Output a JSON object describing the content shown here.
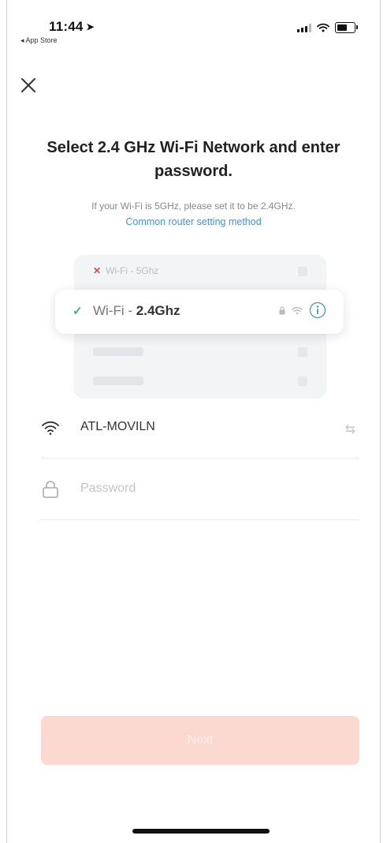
{
  "status_bar": {
    "time": "11:44",
    "back_app": "◂ App Store"
  },
  "page": {
    "title": "Select 2.4 GHz Wi-Fi Network and enter password.",
    "hint": "If your Wi-Fi is 5GHz, please set it to be 2.4GHz.",
    "link": "Common router setting method"
  },
  "illustration": {
    "wifi_5g_prefix": "Wi-Fi - ",
    "wifi_5g_band": "5Ghz",
    "wifi_24_prefix": "Wi-Fi - ",
    "wifi_24_band": "2.4Ghz"
  },
  "form": {
    "ssid": "ATL-MOVILN",
    "password_placeholder": "Password"
  },
  "footer": {
    "next_label": "Next"
  },
  "colors": {
    "accent_blue": "#4a8fd8",
    "check_green": "#3cb46e",
    "error_red": "#e9474c",
    "next_disabled_bg": "#fcd9d0"
  },
  "icons": [
    "location-arrow-icon",
    "signal-icon",
    "wifi-icon",
    "battery-icon",
    "close-icon",
    "x-icon",
    "check-icon",
    "lock-icon",
    "info-icon",
    "switch-network-icon"
  ]
}
